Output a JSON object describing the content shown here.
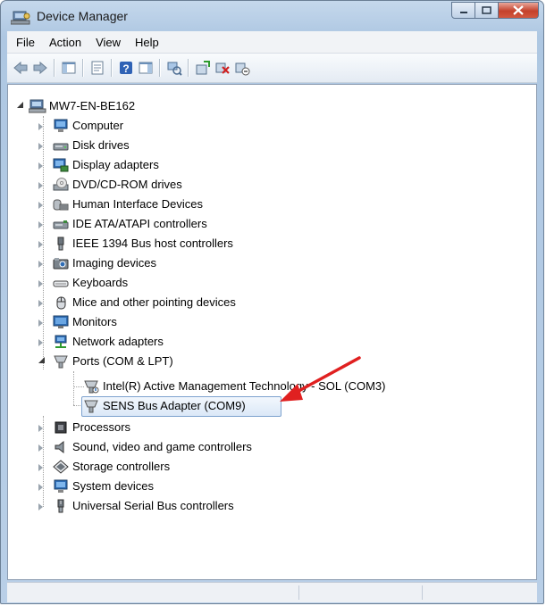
{
  "window": {
    "title": "Device Manager",
    "controls": {
      "minimize": "minimize",
      "maximize": "maximize",
      "close": "close"
    }
  },
  "menu": [
    "File",
    "Action",
    "View",
    "Help"
  ],
  "toolbar_icons": [
    "back-arrow-icon",
    "forward-arrow-icon",
    "show-hide-console-tree-icon",
    "properties-icon",
    "help-icon",
    "show-action-pane-icon",
    "scan-hardware-icon",
    "update-driver-icon",
    "uninstall-device-icon",
    "disable-device-icon"
  ],
  "tree": {
    "root": "MW7-EN-BE162",
    "categories": [
      {
        "label": "Computer",
        "icon": "computer-icon"
      },
      {
        "label": "Disk drives",
        "icon": "disk-drive-icon"
      },
      {
        "label": "Display adapters",
        "icon": "display-adapter-icon"
      },
      {
        "label": "DVD/CD-ROM drives",
        "icon": "dvd-drive-icon"
      },
      {
        "label": "Human Interface Devices",
        "icon": "hid-icon"
      },
      {
        "label": "IDE ATA/ATAPI controllers",
        "icon": "ide-controller-icon"
      },
      {
        "label": "IEEE 1394 Bus host controllers",
        "icon": "firewire-icon"
      },
      {
        "label": "Imaging devices",
        "icon": "camera-icon"
      },
      {
        "label": "Keyboards",
        "icon": "keyboard-icon"
      },
      {
        "label": "Mice and other pointing devices",
        "icon": "mouse-icon"
      },
      {
        "label": "Monitors",
        "icon": "monitor-icon"
      },
      {
        "label": "Network adapters",
        "icon": "network-adapter-icon"
      },
      {
        "label": "Ports (COM & LPT)",
        "icon": "port-icon",
        "expanded": true,
        "children": [
          {
            "label": "Intel(R) Active Management Technology - SOL (COM3)",
            "icon": "port-icon"
          },
          {
            "label": "SENS Bus Adapter (COM9)",
            "icon": "port-icon",
            "selected": true
          }
        ]
      },
      {
        "label": "Processors",
        "icon": "processor-icon"
      },
      {
        "label": "Sound, video and game controllers",
        "icon": "sound-icon"
      },
      {
        "label": "Storage controllers",
        "icon": "storage-controller-icon"
      },
      {
        "label": "System devices",
        "icon": "system-device-icon"
      },
      {
        "label": "Universal Serial Bus controllers",
        "icon": "usb-icon"
      }
    ]
  },
  "annotation": {
    "arrow_color": "#e02020",
    "points_to": "SENS Bus Adapter (COM9)"
  },
  "colors": {
    "selection_border": "#7da2ce",
    "frame": "#b9cfe7",
    "close_button": "#c4412b"
  }
}
